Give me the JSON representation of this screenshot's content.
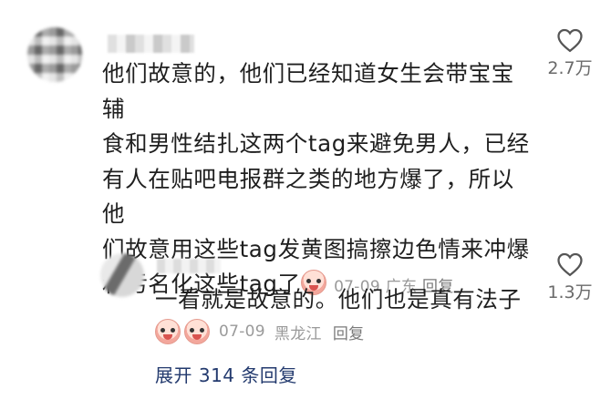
{
  "comment": {
    "lines": [
      "他们故意的，他们已经知道女生会带宝宝辅",
      "食和男性结扎这两个tag来避免男人，已经",
      "有人在贴吧电报群之类的地方爆了，所以他",
      "们故意用这些tag发黄图搞擦边色情来冲爆",
      "和污名化这些tag了"
    ],
    "date": "07-09",
    "location": "广东",
    "reply_label": "回复",
    "likes": "2.7万"
  },
  "reply": {
    "text": "一看就是故意的。他们也是真有法子",
    "date": "07-09",
    "location": "黑龙江",
    "reply_label": "回复",
    "likes": "1.3万"
  },
  "expand_label": "展开 314 条回复",
  "icons": {
    "like": "heart-outline-icon",
    "emoji": "crying-face-emoji"
  },
  "colors": {
    "meta": "#9a9a9a",
    "expand": "#233a6e"
  }
}
